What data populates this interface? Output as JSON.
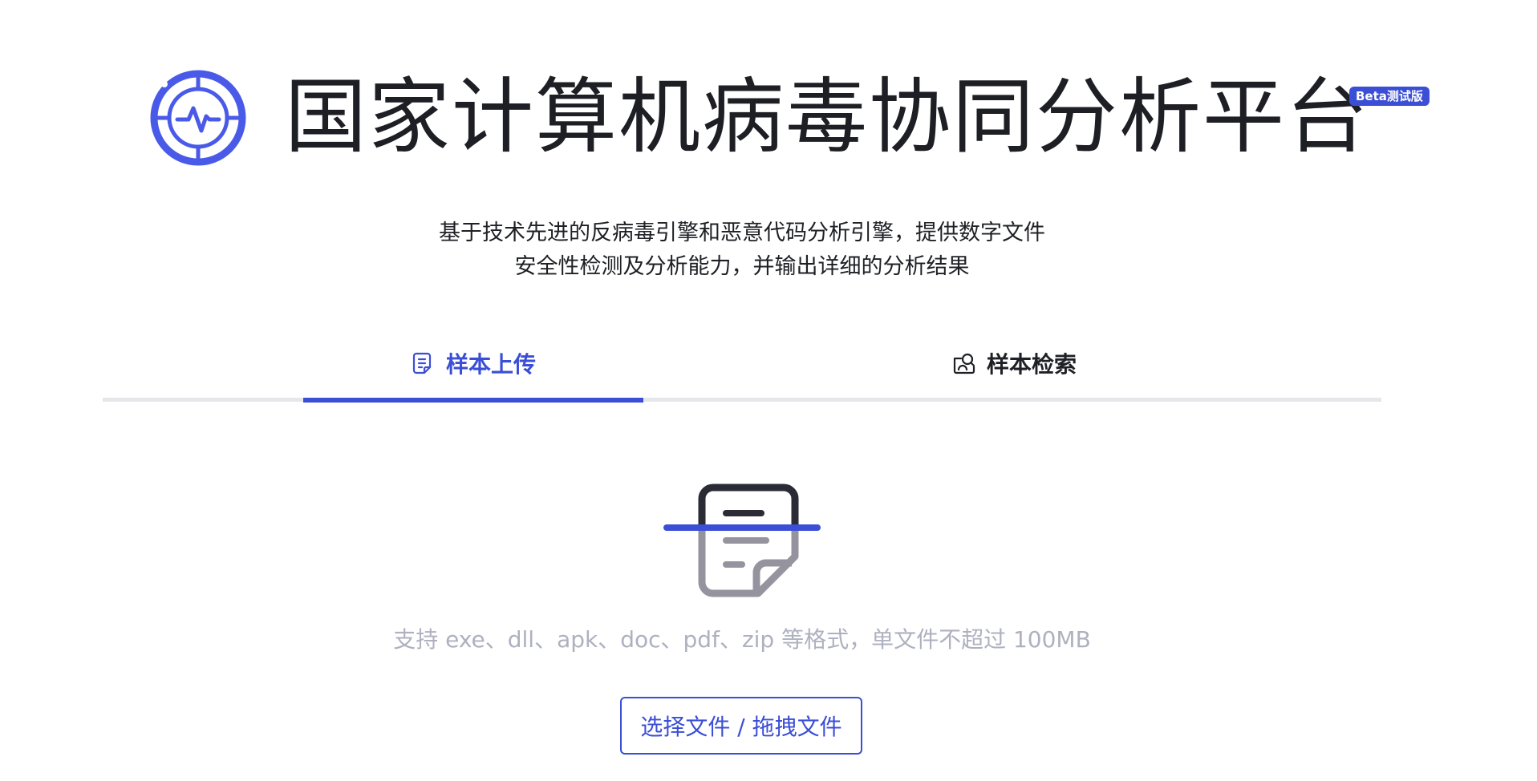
{
  "header": {
    "title": "国家计算机病毒协同分析平台",
    "beta_badge": "Beta测试版",
    "logo_icon": "activity-pulse-icon"
  },
  "description": {
    "line1": "基于技术先进的反病毒引擎和恶意代码分析引擎，提供数字文件",
    "line2": "安全性检测及分析能力，并输出详细的分析结果"
  },
  "tabs": [
    {
      "label": "样本上传",
      "icon": "document-icon",
      "active": true
    },
    {
      "label": "样本检索",
      "icon": "search-user-icon",
      "active": false
    }
  ],
  "upload": {
    "hint": "支持 exe、dll、apk、doc、pdf、zip 等格式，单文件不超过 100MB",
    "button_label": "选择文件 / 拖拽文件",
    "illustration_icon": "document-scan-icon"
  },
  "colors": {
    "accent": "#3b4ed6",
    "text": "#1f2026",
    "muted": "#aeb1bf",
    "divider": "#e6e7eb"
  }
}
